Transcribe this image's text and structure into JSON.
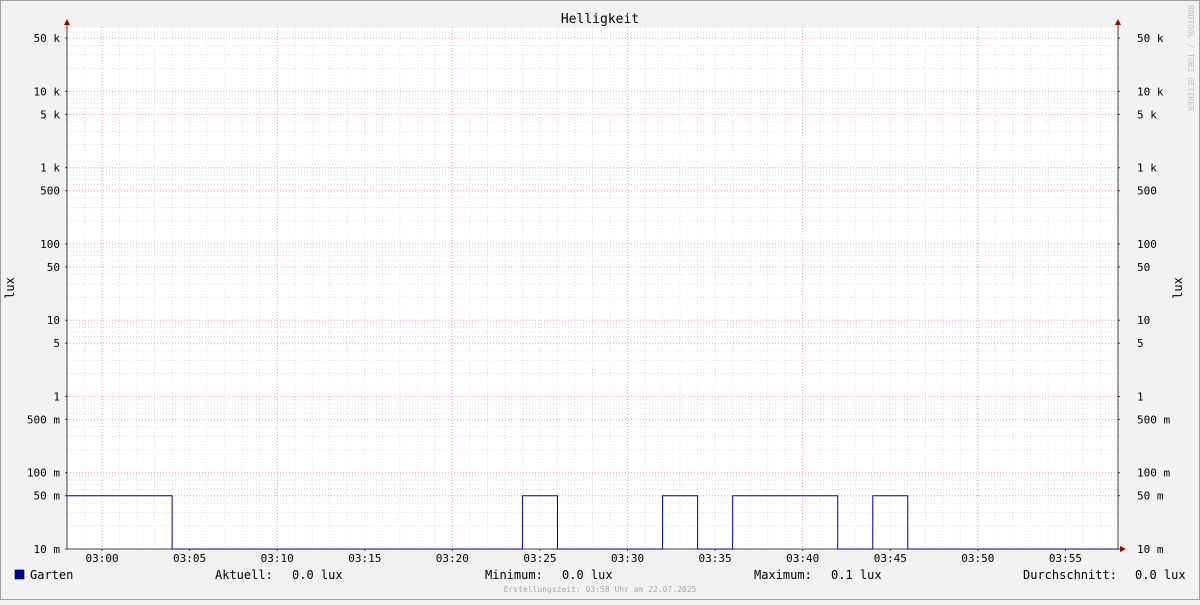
{
  "chart_data": {
    "type": "line",
    "title": "Helligkeit",
    "ylabel": "lux",
    "ylabel_right": "lux",
    "yscale": "log",
    "ylim": [
      0.01,
      70000
    ],
    "xlim": [
      "02:58",
      "03:58"
    ],
    "grid": true,
    "y_ticks": [
      {
        "value": 50000,
        "label": "50 k"
      },
      {
        "value": 10000,
        "label": "10 k"
      },
      {
        "value": 5000,
        "label": "5 k"
      },
      {
        "value": 1000,
        "label": "1 k"
      },
      {
        "value": 500,
        "label": "500"
      },
      {
        "value": 100,
        "label": "100"
      },
      {
        "value": 50,
        "label": "50"
      },
      {
        "value": 10,
        "label": "10"
      },
      {
        "value": 5,
        "label": "5"
      },
      {
        "value": 1,
        "label": "1"
      },
      {
        "value": 0.5,
        "label": "500 m"
      },
      {
        "value": 0.1,
        "label": "100 m"
      },
      {
        "value": 0.05,
        "label": "50 m"
      },
      {
        "value": 0.01,
        "label": "10 m"
      }
    ],
    "x_ticks": [
      "03:00",
      "03:05",
      "03:10",
      "03:15",
      "03:20",
      "03:25",
      "03:30",
      "03:35",
      "03:40",
      "03:45",
      "03:50",
      "03:55"
    ],
    "series": [
      {
        "name": "Garten",
        "color": "#0000aa",
        "step": true,
        "points": [
          [
            "02:58",
            0.05
          ],
          [
            "03:04",
            0.0
          ],
          [
            "03:24",
            0.05
          ],
          [
            "03:26",
            0.0
          ],
          [
            "03:32",
            0.05
          ],
          [
            "03:34",
            0.0
          ],
          [
            "03:36",
            0.05
          ],
          [
            "03:42",
            0.0
          ],
          [
            "03:44",
            0.05
          ],
          [
            "03:46",
            0.0
          ],
          [
            "03:58",
            0.0
          ]
        ]
      }
    ]
  },
  "legend": {
    "series_name": "Garten",
    "swatch_color": "#0000aa",
    "current_label": "Aktuell:",
    "current_value": "0.0 lux",
    "min_label": "Minimum:",
    "min_value": "0.0 lux",
    "max_label": "Maximum:",
    "max_value": "0.1 lux",
    "avg_label": "Durchschnitt:",
    "avg_value": "0.0 lux"
  },
  "footer": "Erstellungszeit: 03:58 Uhr am 22.07.2025",
  "watermark": "RRDTOOL / TOBI OETIKER"
}
